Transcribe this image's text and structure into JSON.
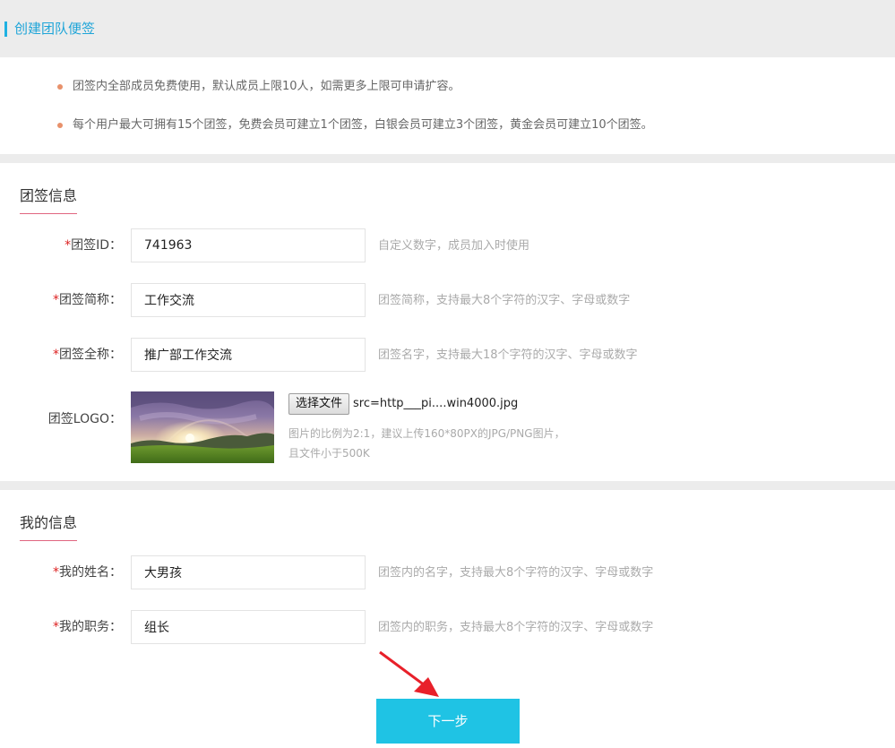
{
  "header": {
    "title": "创建团队便签"
  },
  "notes": [
    "团签内全部成员免费使用，默认成员上限10人，如需更多上限可申请扩容。",
    "每个用户最大可拥有15个团签，免费会员可建立1个团签，白银会员可建立3个团签，黄金会员可建立10个团签。"
  ],
  "team_info": {
    "section_title": "团签信息",
    "id": {
      "required_mark": "*",
      "label": "团签ID：",
      "value": "741963",
      "hint": "自定义数字，成员加入时使用"
    },
    "short_name": {
      "required_mark": "*",
      "label": "团签简称：",
      "value": "工作交流",
      "hint": "团签简称，支持最大8个字符的汉字、字母或数字"
    },
    "full_name": {
      "required_mark": "*",
      "label": "团签全称：",
      "value": "推广部工作交流",
      "hint": "团签名字，支持最大18个字符的汉字、字母或数字"
    },
    "logo": {
      "label": "团签LOGO：",
      "choose_button": "选择文件",
      "file_name": "src=http___pi....win4000.jpg",
      "tip_line1": "图片的比例为2:1，建议上传160*80PX的JPG/PNG图片，",
      "tip_line2": "且文件小于500K"
    }
  },
  "my_info": {
    "section_title": "我的信息",
    "name": {
      "required_mark": "*",
      "label": "我的姓名：",
      "value": "大男孩",
      "hint": "团签内的名字，支持最大8个字符的汉字、字母或数字"
    },
    "position": {
      "required_mark": "*",
      "label": "我的职务：",
      "value": "组长",
      "hint": "团签内的职务，支持最大8个字符的汉字、字母或数字"
    }
  },
  "next_button": "下一步",
  "colors": {
    "accent": "#1fc3e4",
    "title_blue": "#1fa5d8",
    "required_red": "#dd2222",
    "bullet": "#e8916b",
    "underline": "#e06680",
    "arrow": "#e8202a"
  }
}
